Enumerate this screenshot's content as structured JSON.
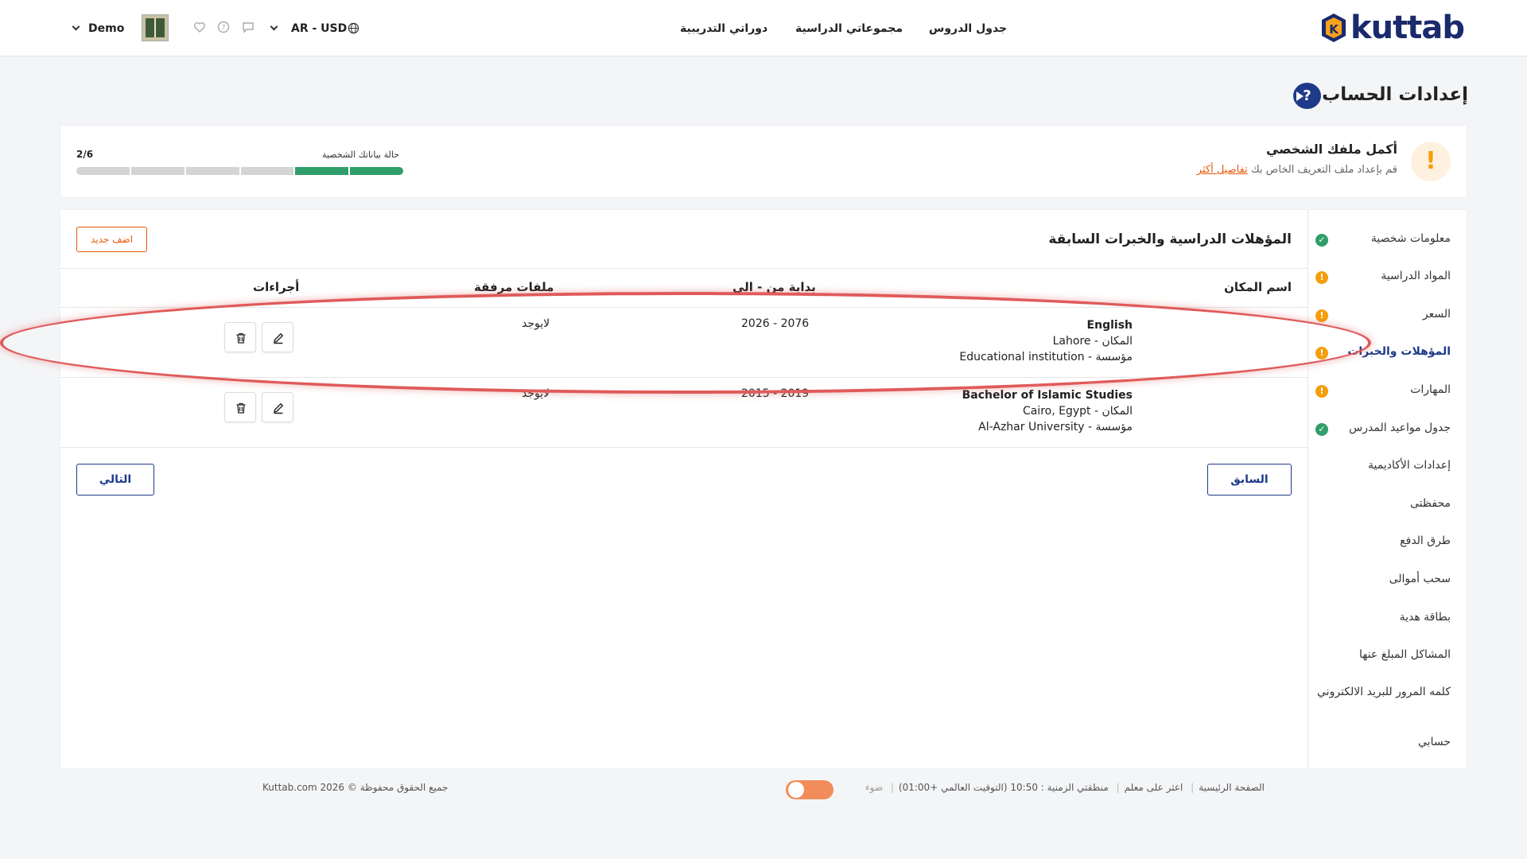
{
  "header": {
    "brand": "kuttab",
    "nav": [
      "جدول الدروس",
      "مجموعاتي الدراسية",
      "دوراتي التدريبية"
    ],
    "locale": "AR - USD",
    "user": "Demo"
  },
  "page": {
    "title": "إعدادات الحساب"
  },
  "banner": {
    "title": "أكمل ملفك الشخصي",
    "subtitle": "قم بإعداد ملف التعريف الخاص بك",
    "details_link": "تفاصيل أكثر",
    "progress_label": "حالة بياناتك الشخصية",
    "progress_count": "2/6",
    "progress_done": 2,
    "progress_total": 6
  },
  "sidebar": {
    "items": [
      {
        "label": "معلومات شخصية",
        "status": "ok"
      },
      {
        "label": "المواد الدراسية",
        "status": "warn"
      },
      {
        "label": "السعر",
        "status": "warn"
      },
      {
        "label": "المؤهلات والخبرات",
        "status": "warn"
      },
      {
        "label": "المهارات",
        "status": "warn"
      },
      {
        "label": "جدول مواعيد المدرس",
        "status": "ok"
      },
      {
        "label": "إعدادات الأكاديمية",
        "status": ""
      },
      {
        "label": "محفظتى",
        "status": ""
      },
      {
        "label": "طرق الدفع",
        "status": ""
      },
      {
        "label": "سحب أموالى",
        "status": ""
      },
      {
        "label": "بطاقة هدية",
        "status": ""
      },
      {
        "label": "المشاكل المبلغ عنها",
        "status": ""
      },
      {
        "label": "كلمه المرور للبريد الالكتروني",
        "status": ""
      },
      {
        "label": "حسابي",
        "status": ""
      }
    ]
  },
  "section": {
    "title": "المؤهلات الدراسية والخبرات السابقة",
    "add_button": "اضف جديد",
    "columns": [
      "اسم المكان",
      "بداية من - الى",
      "ملفات مرفقة",
      "أجراءات"
    ],
    "rows": [
      {
        "name": "English",
        "place": "المكان - Lahore",
        "institution": "مؤسسة - Educational institution",
        "period": "2026 - 2076",
        "files": "لايوجد"
      },
      {
        "name": "Bachelor of Islamic Studies",
        "place": "المكان - Cairo, Egypt",
        "institution": "مؤسسة - Al-Azhar University",
        "period": "2015 - 2019",
        "files": "لايوجد"
      }
    ],
    "prev_button": "السابق",
    "next_button": "التالي"
  },
  "footer": {
    "links": [
      "الصفحة الرئيسية",
      "اعثر على معلم",
      "منطقتي الزمنية : 10:50 (التوقيت العالمي +01:00)",
      "ضوء"
    ],
    "copyright": "جميع الحقوق محفوظة © 2026 Kuttab.com"
  },
  "colors": {
    "primary": "#1e3a8a",
    "accent": "#e8590c",
    "success": "#2f9e6a",
    "warning": "#f59e0b",
    "highlight": "#e05a5a"
  },
  "icons": {
    "logo": "kuttab-logo",
    "globe": "globe-icon",
    "heart": "heart-icon",
    "help": "question-icon",
    "chat": "chat-icon",
    "edit": "pencil-icon",
    "delete": "trash-icon",
    "warning": "exclamation-icon",
    "check": "check-icon"
  }
}
